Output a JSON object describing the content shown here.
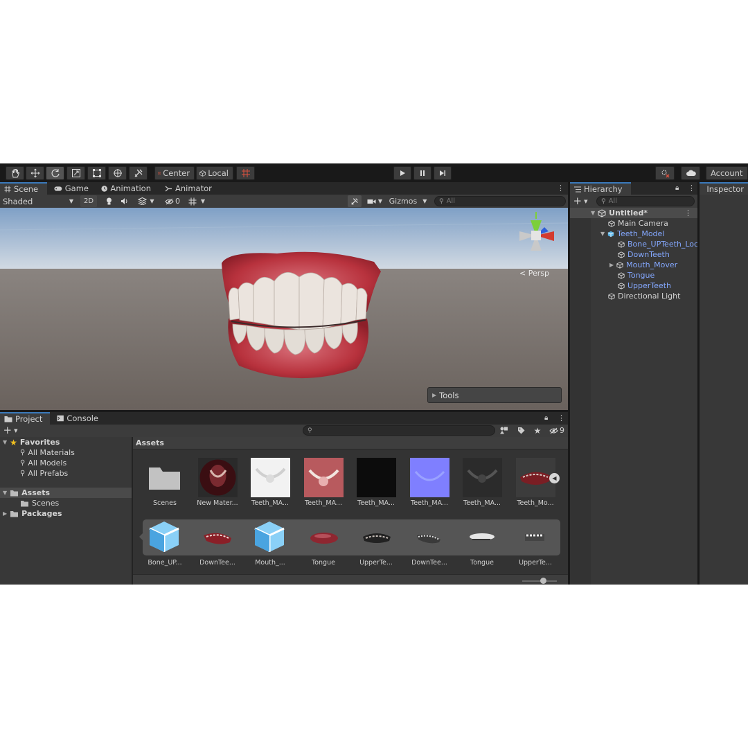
{
  "toolbar": {
    "center_label": "Center",
    "local_label": "Local",
    "account_label": "Account"
  },
  "scene_tabs": [
    {
      "label": "Scene"
    },
    {
      "label": "Game"
    },
    {
      "label": "Animation"
    },
    {
      "label": "Animator"
    }
  ],
  "scene_toolbar": {
    "shading_mode": "Shaded",
    "mode_2d": "2D",
    "hidden_count": "0",
    "gizmos_label": "Gizmos",
    "search_placeholder": "All"
  },
  "viewport": {
    "projection_label": "< Persp",
    "tools_overlay_label": "Tools"
  },
  "hierarchy": {
    "tab_label": "Hierarchy",
    "search_placeholder": "All",
    "scene_name": "Untitled*",
    "items": [
      {
        "label": "Main Camera",
        "type": "gameobject",
        "indent": 1
      },
      {
        "label": "Teeth_Model",
        "type": "prefab",
        "indent": 1,
        "expanded": true
      },
      {
        "label": "Bone_UPTeeth_Loc",
        "type": "prefab-child",
        "indent": 2
      },
      {
        "label": "DownTeeth",
        "type": "prefab-child",
        "indent": 2
      },
      {
        "label": "Mouth_Mover",
        "type": "prefab-child",
        "indent": 2,
        "collapsed": true
      },
      {
        "label": "Tongue",
        "type": "prefab-child",
        "indent": 2
      },
      {
        "label": "UpperTeeth",
        "type": "prefab-child",
        "indent": 2
      },
      {
        "label": "Directional Light",
        "type": "gameobject",
        "indent": 1
      }
    ]
  },
  "inspector": {
    "tab_label": "Inspector"
  },
  "project": {
    "tabs": [
      {
        "label": "Project"
      },
      {
        "label": "Console"
      }
    ],
    "hidden_count": "9",
    "breadcrumb": "Assets",
    "favorites_label": "Favorites",
    "favorites": [
      {
        "label": "All Materials"
      },
      {
        "label": "All Models"
      },
      {
        "label": "All Prefabs"
      }
    ],
    "assets_label": "Assets",
    "assets_children": [
      {
        "label": "Scenes"
      }
    ],
    "packages_label": "Packages",
    "grid_row1": [
      {
        "label": "Scenes",
        "kind": "folder"
      },
      {
        "label": "New Mater...",
        "kind": "material"
      },
      {
        "label": "Teeth_MA...",
        "kind": "tex-white"
      },
      {
        "label": "Teeth_MA...",
        "kind": "tex-red"
      },
      {
        "label": "Teeth_MA...",
        "kind": "tex-black"
      },
      {
        "label": "Teeth_MA...",
        "kind": "tex-normal"
      },
      {
        "label": "Teeth_MA...",
        "kind": "tex-gray"
      },
      {
        "label": "Teeth_Mo...",
        "kind": "model"
      }
    ],
    "grid_row2": [
      {
        "label": "Bone_UP...",
        "kind": "prefab"
      },
      {
        "label": "DownTee...",
        "kind": "mesh-red"
      },
      {
        "label": "Mouth_...",
        "kind": "prefab"
      },
      {
        "label": "Tongue",
        "kind": "mesh-tongue"
      },
      {
        "label": "UpperTe...",
        "kind": "mesh-upper"
      },
      {
        "label": "DownTee...",
        "kind": "mesh-gray"
      },
      {
        "label": "Tongue",
        "kind": "mesh-white"
      },
      {
        "label": "UpperTe...",
        "kind": "mesh-gray2"
      }
    ]
  },
  "colors": {
    "accent_blue": "#3a79bb",
    "prefab_blue": "#84a8ff",
    "panel_bg": "#383838",
    "toolbar_bg": "#191919",
    "gums": "#b8323d",
    "teeth": "#e8e2dc"
  }
}
